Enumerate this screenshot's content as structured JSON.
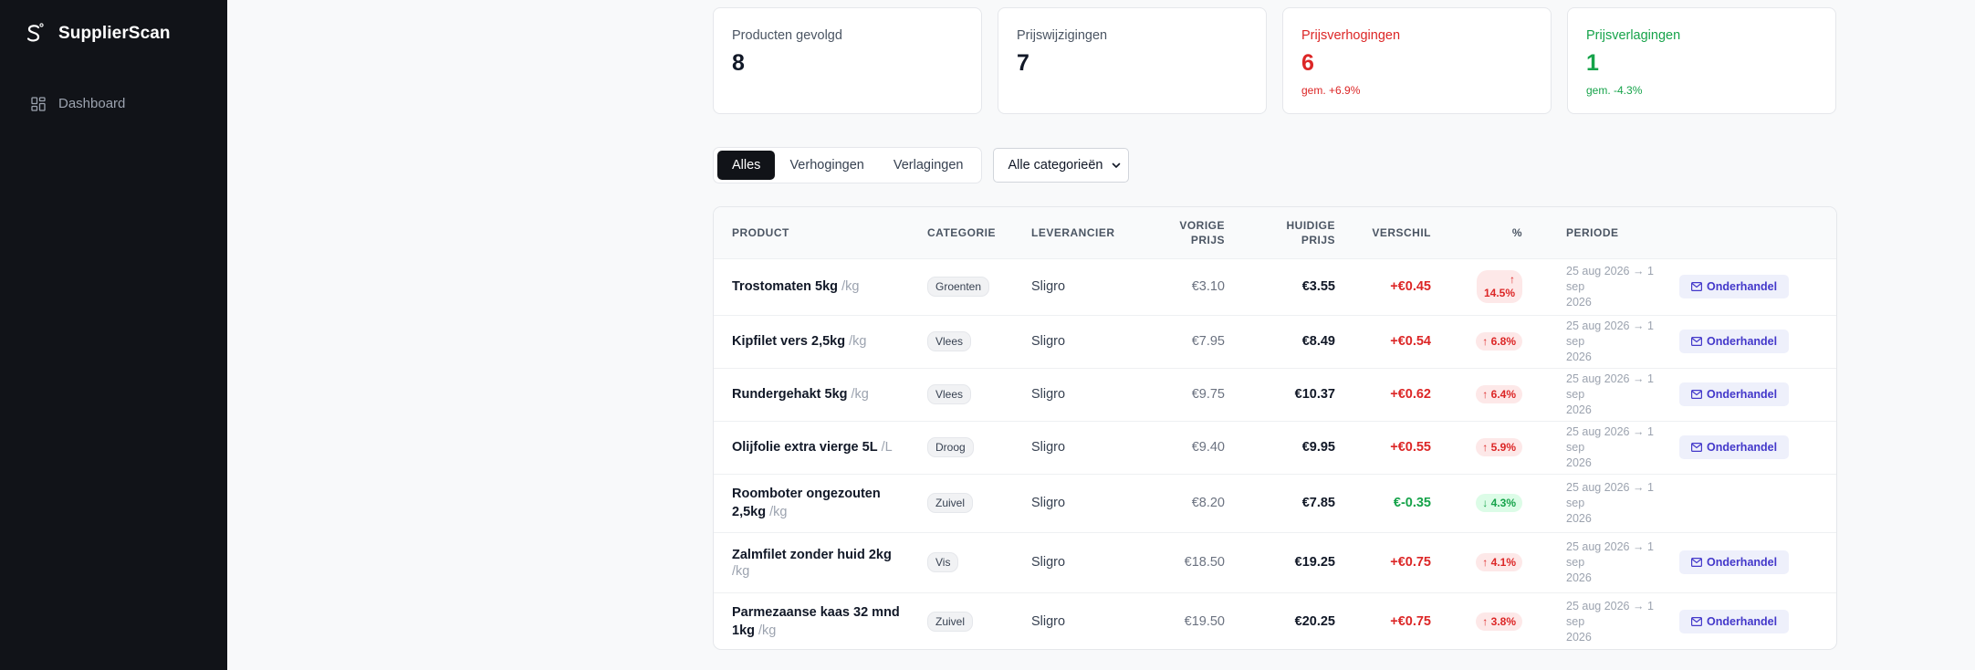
{
  "app": {
    "name": "SupplierScan"
  },
  "sidebar": {
    "items": [
      {
        "label": "Dashboard",
        "icon": "dashboard-grid-icon"
      }
    ]
  },
  "stats": [
    {
      "label": "Producten gevolgd",
      "value": "8",
      "sub": "",
      "tone": "neutral"
    },
    {
      "label": "Prijswijzigingen",
      "value": "7",
      "sub": "",
      "tone": "neutral"
    },
    {
      "label": "Prijsverhogingen",
      "value": "6",
      "sub": "gem. +6.9%",
      "tone": "red"
    },
    {
      "label": "Prijsverlagingen",
      "value": "1",
      "sub": "gem. -4.3%",
      "tone": "green"
    }
  ],
  "filters": {
    "tabs": [
      {
        "label": "Alles",
        "active": true
      },
      {
        "label": "Verhogingen",
        "active": false
      },
      {
        "label": "Verlagingen",
        "active": false
      }
    ],
    "category_select": "Alle categorieën"
  },
  "table": {
    "headers": {
      "product": "PRODUCT",
      "category": "CATEGORIE",
      "supplier": "LEVERANCIER",
      "prev_line1": "VORIGE",
      "prev_line2": "PRIJS",
      "cur_line1": "HUIDIGE",
      "cur_line2": "PRIJS",
      "diff": "VERSCHIL",
      "pct": "%",
      "period": "PERIODE"
    },
    "action_label": "Onderhandel",
    "rows": [
      {
        "name": "Trostomaten 5kg",
        "unit": "/kg",
        "category": "Groenten",
        "supplier": "Sligro",
        "prev": "€3.10",
        "cur": "€3.55",
        "diff": "+€0.45",
        "pct": "14.5%",
        "dir": "up",
        "period1": "25 aug 2026 → 1 sep",
        "period2": "2026",
        "action": true
      },
      {
        "name": "Kipfilet vers 2,5kg",
        "unit": "/kg",
        "category": "Vlees",
        "supplier": "Sligro",
        "prev": "€7.95",
        "cur": "€8.49",
        "diff": "+€0.54",
        "pct": "6.8%",
        "dir": "up",
        "period1": "25 aug 2026 → 1 sep",
        "period2": "2026",
        "action": true
      },
      {
        "name": "Rundergehakt 5kg",
        "unit": "/kg",
        "category": "Vlees",
        "supplier": "Sligro",
        "prev": "€9.75",
        "cur": "€10.37",
        "diff": "+€0.62",
        "pct": "6.4%",
        "dir": "up",
        "period1": "25 aug 2026 → 1 sep",
        "period2": "2026",
        "action": true
      },
      {
        "name": "Olijfolie extra vierge 5L",
        "unit": "/L",
        "category": "Droog",
        "supplier": "Sligro",
        "prev": "€9.40",
        "cur": "€9.95",
        "diff": "+€0.55",
        "pct": "5.9%",
        "dir": "up",
        "period1": "25 aug 2026 → 1 sep",
        "period2": "2026",
        "action": true
      },
      {
        "name": "Roomboter ongezouten 2,5kg",
        "unit": "/kg",
        "category": "Zuivel",
        "supplier": "Sligro",
        "prev": "€8.20",
        "cur": "€7.85",
        "diff": "€-0.35",
        "pct": "4.3%",
        "dir": "down",
        "period1": "25 aug 2026 → 1 sep",
        "period2": "2026",
        "action": false
      },
      {
        "name": "Zalmfilet zonder huid 2kg",
        "unit": "/kg",
        "category": "Vis",
        "supplier": "Sligro",
        "prev": "€18.50",
        "cur": "€19.25",
        "diff": "+€0.75",
        "pct": "4.1%",
        "dir": "up",
        "period1": "25 aug 2026 → 1 sep",
        "period2": "2026",
        "action": true
      },
      {
        "name": "Parmezaanse kaas 32 mnd 1kg",
        "unit": "/kg",
        "category": "Zuivel",
        "supplier": "Sligro",
        "prev": "€19.50",
        "cur": "€20.25",
        "diff": "+€0.75",
        "pct": "3.8%",
        "dir": "up",
        "period1": "25 aug 2026 → 1 sep",
        "period2": "2026",
        "action": true
      }
    ]
  },
  "colors": {
    "sidebar": "#111318",
    "increase": "#dc2626",
    "decrease": "#16a34a",
    "action": "#4338ca"
  }
}
